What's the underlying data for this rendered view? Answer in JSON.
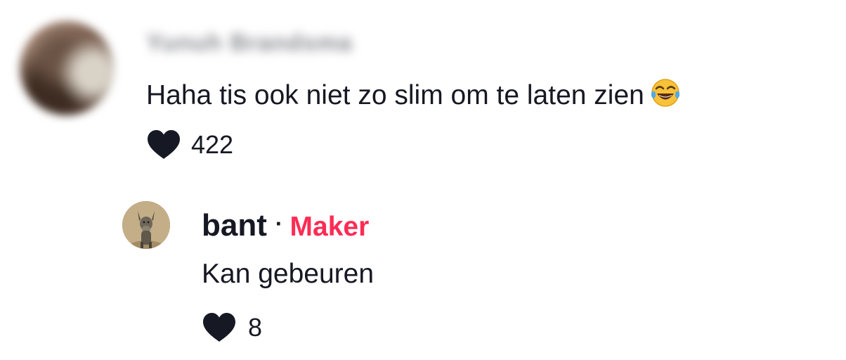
{
  "comment": {
    "username": "Yunuh Brandsma",
    "text": "Haha tis ook niet zo slim om te laten zien",
    "emoji": "tears-of-joy-emoji",
    "like_count": "422"
  },
  "reply": {
    "username": "bant",
    "separator": "·",
    "badge": "Maker",
    "text": "Kan gebeuren",
    "like_count": "8"
  },
  "colors": {
    "text": "#161823",
    "badge": "#fe2c55",
    "heart": "#161823"
  }
}
